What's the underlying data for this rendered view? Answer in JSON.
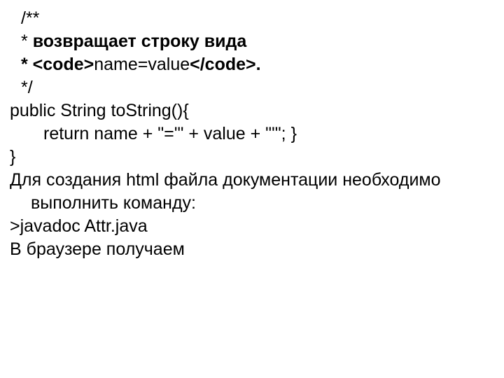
{
  "lines": {
    "l1": " /**",
    "l2a": "*  ",
    "l2b": "возвращает строку вида",
    "l3a": "*  <code>",
    "l3b": "name=value",
    "l3c": "</code>.",
    "l4": "*/",
    "l5": "public String toString(){",
    "l6": "return name + \"='\" + value + \"'\"; }",
    "l7": "}",
    "l8": "Для создания html файла документации необходимо выполнить команду:",
    "l9": ">javadoc Attr.java",
    "l10": "В браузере получаем"
  }
}
